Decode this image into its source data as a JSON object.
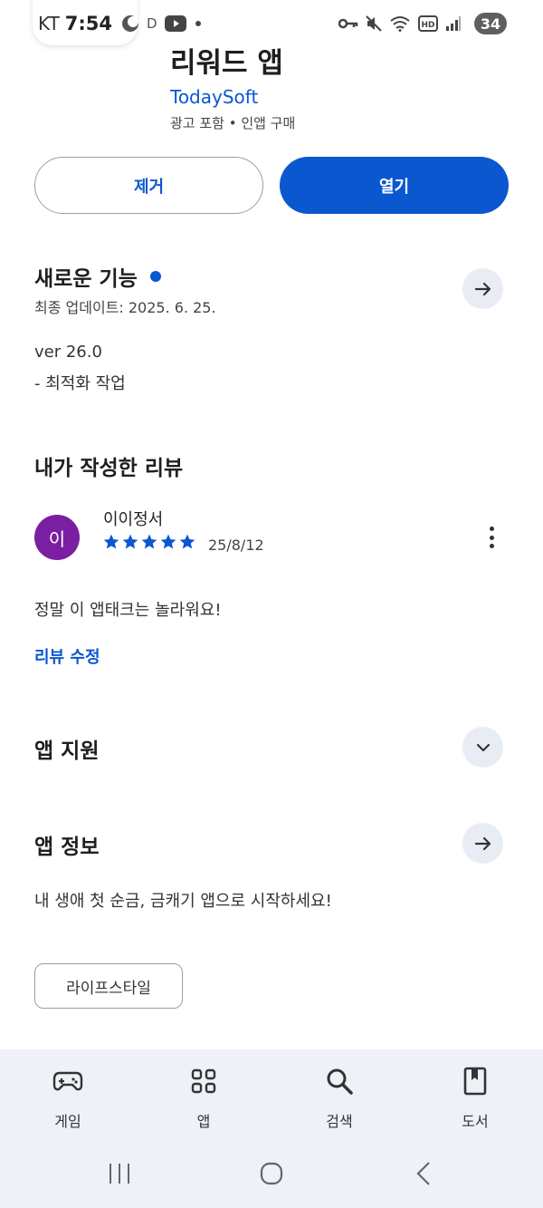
{
  "status_bar": {
    "carrier": "KT",
    "time": "7:54",
    "battery": "34",
    "icons_left": [
      "moon-icon",
      "d-icon",
      "youtube-icon",
      "dot-icon"
    ],
    "icons_right": [
      "key-icon",
      "mute-icon",
      "wifi-icon",
      "hd-icon",
      "signal-icon"
    ]
  },
  "app": {
    "title": "리워드 앱",
    "developer": "TodaySoft",
    "meta": "광고 포함 • 인앱 구매"
  },
  "actions": {
    "remove_label": "제거",
    "open_label": "열기"
  },
  "whats_new": {
    "title": "새로운 기능",
    "updated": "최종 업데이트: 2025. 6. 25.",
    "version": "ver 26.0",
    "notes": "- 최적화 작업"
  },
  "my_review": {
    "title": "내가 작성한 리뷰",
    "avatar_initial": "이",
    "reviewer": "이이정서",
    "rating": 5,
    "max_rating": 5,
    "date": "25/8/12",
    "text": "정말 이 앱태크는 놀라워요!",
    "edit_label": "리뷰 수정"
  },
  "app_support": {
    "title": "앱 지원"
  },
  "app_info": {
    "title": "앱 정보",
    "description": "내 생애 첫 순금, 금캐기 앱으로 시작하세요!",
    "category_chip": "라이프스타일"
  },
  "bottom_nav": {
    "items": [
      {
        "label": "게임",
        "icon": "gamepad-icon"
      },
      {
        "label": "앱",
        "icon": "apps-grid-icon"
      },
      {
        "label": "검색",
        "icon": "search-icon"
      },
      {
        "label": "도서",
        "icon": "book-icon"
      }
    ]
  },
  "colors": {
    "accent": "#0b57d0",
    "avatar": "#7b1fa2",
    "round_button_bg": "#e8edf5",
    "nav_bg": "#eef1f8"
  }
}
